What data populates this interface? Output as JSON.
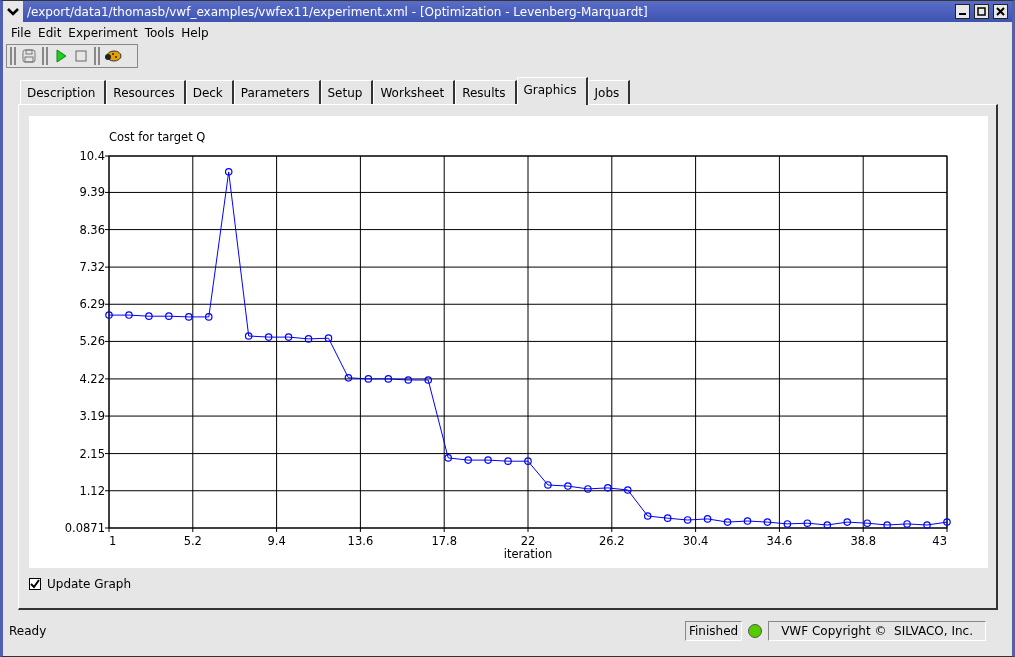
{
  "window": {
    "title": "/export/data1/thomasb/vwf_examples/vwfex11/experiment.xml - [Optimization - Levenberg-Marquardt]"
  },
  "menu": [
    "File",
    "Edit",
    "Experiment",
    "Tools",
    "Help"
  ],
  "tabs": [
    {
      "label": "Description",
      "selected": false
    },
    {
      "label": "Resources",
      "selected": false
    },
    {
      "label": "Deck",
      "selected": false
    },
    {
      "label": "Parameters",
      "selected": false
    },
    {
      "label": "Setup",
      "selected": false
    },
    {
      "label": "Worksheet",
      "selected": false
    },
    {
      "label": "Results",
      "selected": false
    },
    {
      "label": "Graphics",
      "selected": true
    },
    {
      "label": "Jobs",
      "selected": false
    }
  ],
  "graph": {
    "chart_data": {
      "type": "line",
      "title": "Cost for target Q",
      "xlabel": "iteration",
      "x": [
        1,
        2,
        3,
        4,
        5,
        6,
        7,
        8,
        9,
        10,
        11,
        12,
        13,
        14,
        15,
        16,
        17,
        18,
        19,
        20,
        21,
        22,
        23,
        24,
        25,
        26,
        27,
        28,
        29,
        30,
        31,
        32,
        33,
        34,
        35,
        36,
        37,
        38,
        39,
        40,
        41,
        42,
        43
      ],
      "grid": true,
      "series": [
        {
          "color": "#0000ff",
          "marker": "circle",
          "values": [
            5.99,
            5.99,
            5.96,
            5.96,
            5.94,
            5.94,
            9.96,
            5.41,
            5.38,
            5.38,
            5.33,
            5.35,
            4.25,
            4.22,
            4.22,
            4.19,
            4.19,
            2.03,
            1.97,
            1.97,
            1.94,
            1.94,
            1.28,
            1.25,
            1.17,
            1.2,
            1.14,
            0.42,
            0.36,
            0.31,
            0.34,
            0.25,
            0.28,
            0.25,
            0.2,
            0.22,
            0.17,
            0.25,
            0.22,
            0.17,
            0.2,
            0.17,
            0.25
          ]
        }
      ],
      "xlim": [
        1,
        43
      ],
      "ylim": [
        0.0871,
        10.4
      ],
      "xticks": [
        1,
        5.2,
        9.4,
        13.6,
        17.8,
        22,
        26.2,
        30.4,
        34.6,
        38.8,
        43
      ],
      "yticks": [
        0.0871,
        1.12,
        2.15,
        3.19,
        4.22,
        5.26,
        6.29,
        7.32,
        8.36,
        9.39,
        10.4
      ]
    },
    "update_graph": {
      "label": "Update Graph",
      "checked": true
    }
  },
  "status_bar": {
    "message": "Ready",
    "state": "Finished",
    "led_on": true,
    "copyright": "VWF Copyright ©  SILVACO, Inc."
  }
}
